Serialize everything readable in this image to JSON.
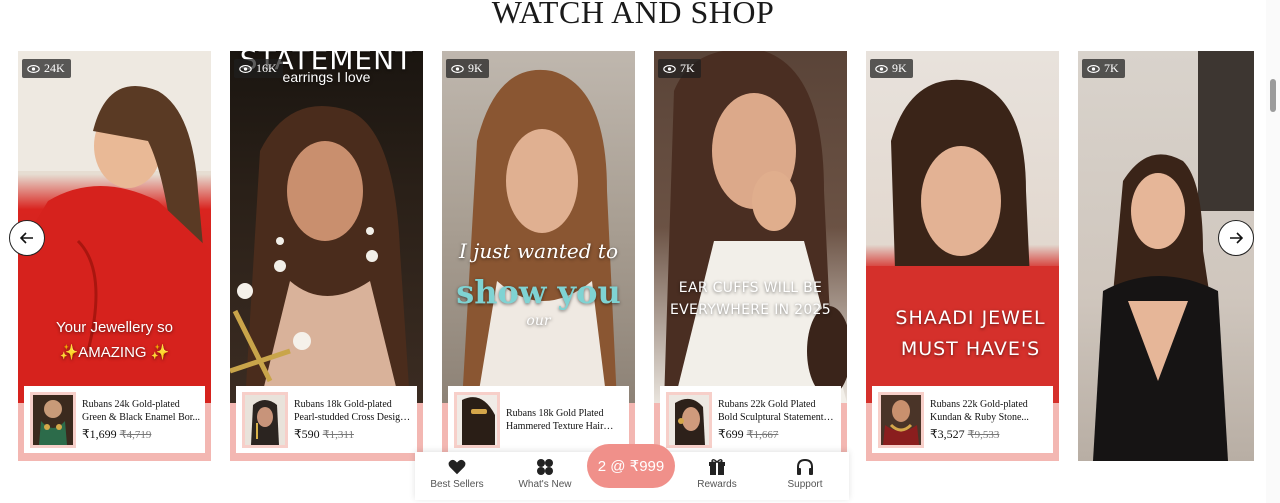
{
  "section": {
    "title": "WATCH AND SHOP"
  },
  "cards": [
    {
      "views": "24K",
      "overlay": [
        "Your Jewellery so",
        "✨AMAZING ✨"
      ],
      "product_name": "Rubans 24k Gold-plated Green & Black Enamel Bor...",
      "price": "₹1,699",
      "old_price": "₹4,719"
    },
    {
      "views": "16K",
      "overlay": [
        "STATEMENT",
        "earrings I love"
      ],
      "product_name": "Rubans 18k Gold-plated Pearl-studded Cross Design Long...",
      "price": "₹590",
      "old_price": "₹1,311"
    },
    {
      "views": "9K",
      "overlay": [
        "I just wanted to",
        "show you",
        "our"
      ],
      "product_name": "Rubans 18k Gold Plated Hammered Texture Hair Tie...",
      "price": "",
      "old_price": ""
    },
    {
      "views": "7K",
      "overlay": [
        "EAR CUFFS WILL BE",
        "EVERYWHERE IN 2025"
      ],
      "product_name": "Rubans 22k Gold Plated Bold Sculptural Statement Luxe...",
      "price": "₹699",
      "old_price": "₹1,667"
    },
    {
      "views": "9K",
      "overlay": [
        "SHAADI JEWEL",
        "MUST HAVE'S"
      ],
      "product_name": "Rubans 22k Gold-plated Kundan & Ruby Stone...",
      "price": "₹3,527",
      "old_price": "₹9,533"
    },
    {
      "views": "7K",
      "overlay": [],
      "product_name": "",
      "price": "",
      "old_price": ""
    }
  ],
  "bottom_nav": {
    "best_sellers": "Best Sellers",
    "whats_new": "What's New",
    "promo": "2 @ ₹999",
    "rewards": "Rewards",
    "support": "Support"
  },
  "colors": {
    "card_border": "#f3b7b2",
    "promo": "#f0908a",
    "overlay_teal": "#7fd3d3"
  },
  "icons": {
    "views": "eye-icon",
    "prev": "arrow-left-icon",
    "next": "arrow-right-icon",
    "best_sellers": "heart-icon",
    "whats_new": "grid-dots-icon",
    "rewards": "gift-icon",
    "support": "headphones-icon"
  }
}
